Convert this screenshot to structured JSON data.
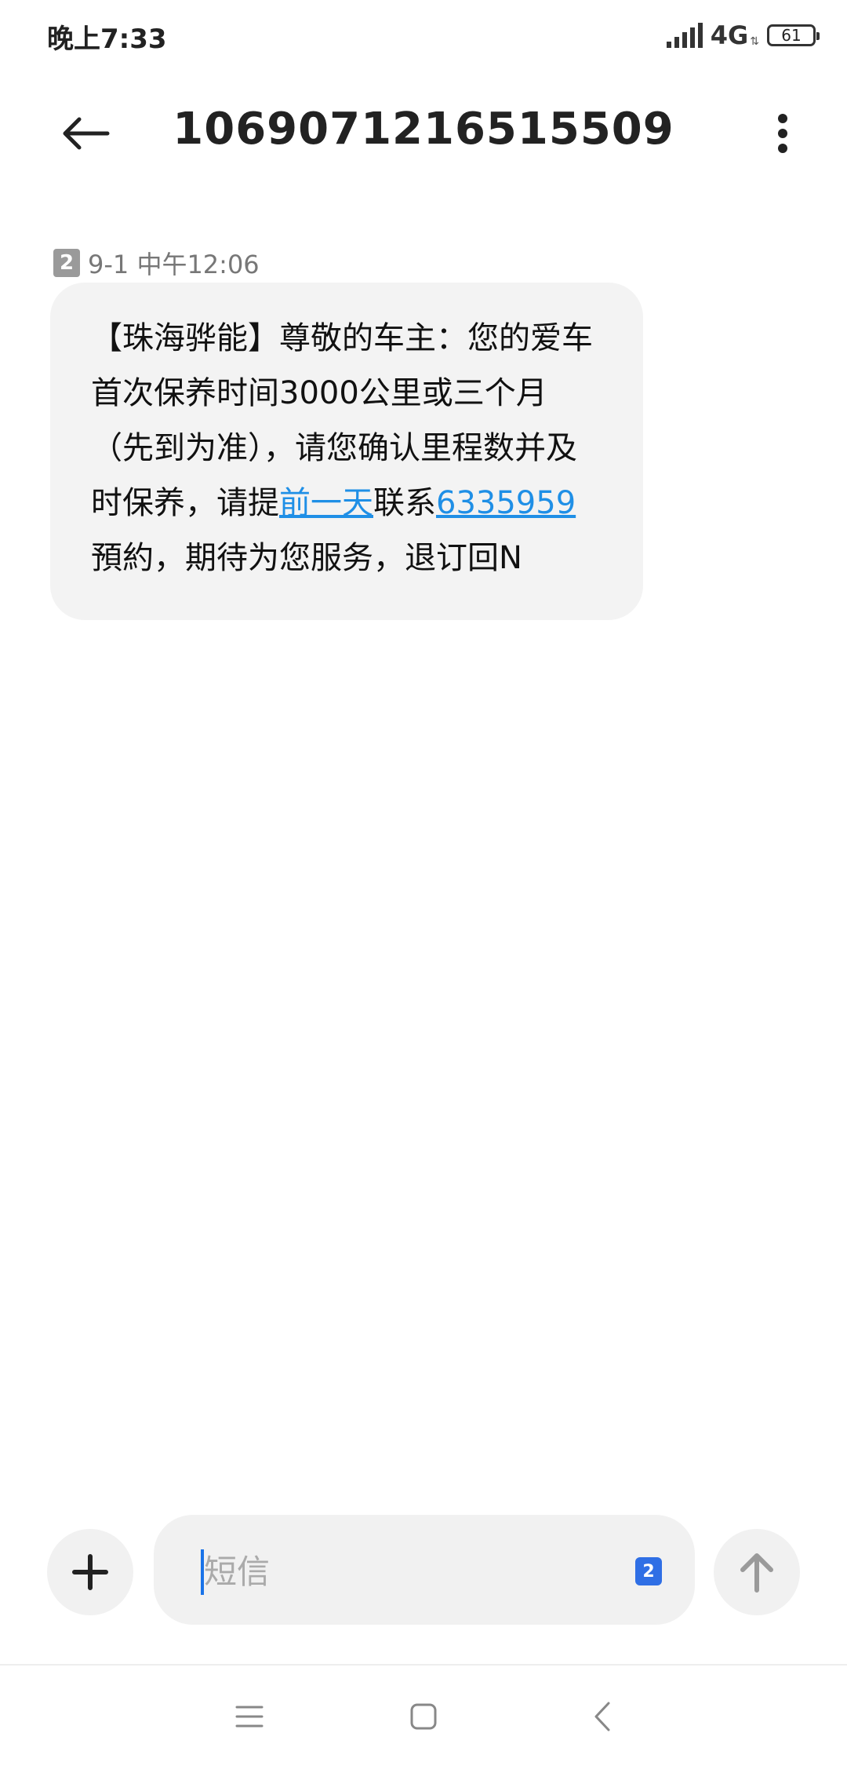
{
  "status": {
    "time": "晚上7:33",
    "network": "4G",
    "battery": "61"
  },
  "header": {
    "title": "1069071216515509",
    "back_icon": "arrow-left-icon",
    "menu_icon": "more-vertical-icon"
  },
  "message": {
    "sim": "2",
    "timestamp": "9-1 中午12:06",
    "text_part1": "【珠海骅能】尊敬的车主：您的爱车首次保养时间3000公里或三个月（先到为准），请您确认里程数并及时保养，请提",
    "link1": "前一天",
    "text_part2": "联系",
    "link2": "6335959",
    "text_part3": "預約，期待为您服务，退订回N"
  },
  "composer": {
    "placeholder": "短信",
    "sim": "2",
    "add_icon": "plus-icon",
    "send_icon": "arrow-up-icon"
  },
  "nav": {
    "menu_icon": "menu-icon",
    "home_icon": "square-icon",
    "back_icon": "chevron-left-icon"
  },
  "colors": {
    "link": "#1f8fe6",
    "bubble": "#f3f3f3",
    "accent": "#2f6fe5"
  }
}
